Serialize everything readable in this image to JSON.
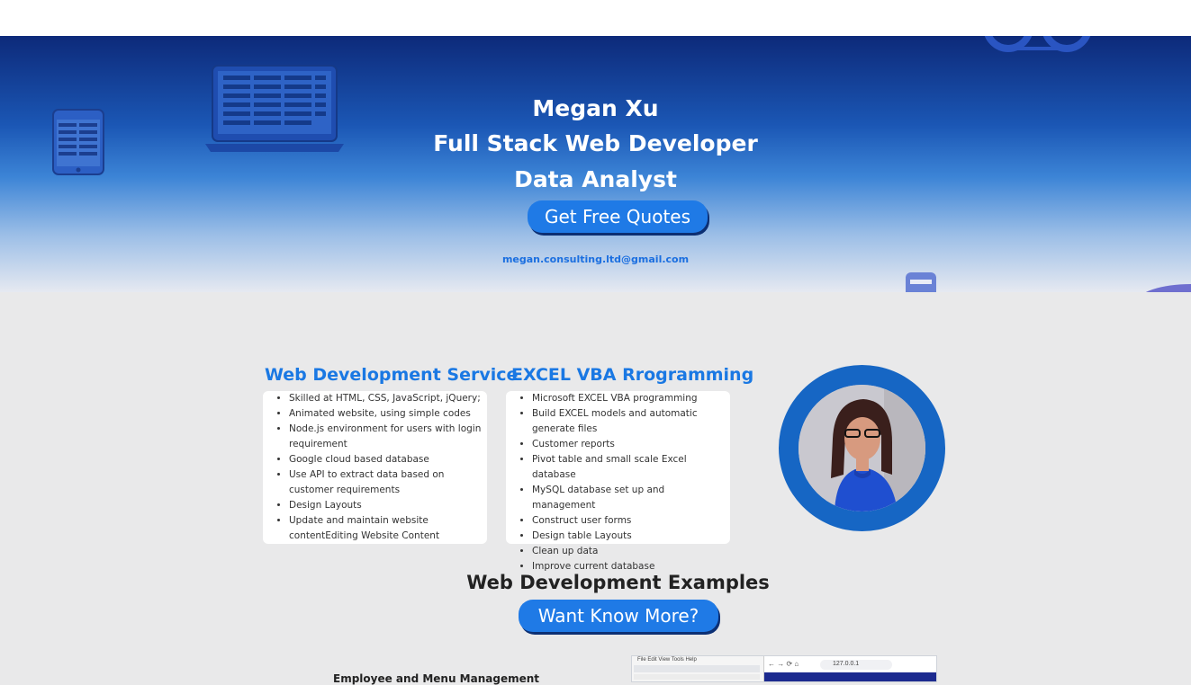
{
  "hero": {
    "name": "Megan Xu",
    "role1": "Full Stack Web Developer",
    "role2": "Data Analyst",
    "quote_button": "Get Free Quotes",
    "email": "megan.consulting.ltd@gmail.com",
    "decorations": [
      "tablet-icon",
      "laptop-icon",
      "phone-icon",
      "gears-icon"
    ]
  },
  "services": [
    {
      "title": "Web Development Service",
      "items": [
        "Skilled at HTML, CSS, JavaScript, jQuery;",
        "Animated website, using simple codes",
        "Node.js environment for users with login requirement",
        "Google cloud based database",
        "Use API to extract data based on customer requirements",
        "Design Layouts",
        "Update and maintain website contentEditing Website Content"
      ]
    },
    {
      "title": "EXCEL VBA Rrogramming",
      "items": [
        "Microsoft EXCEL VBA programming",
        "Build EXCEL models and automatic generate files",
        "Customer reports",
        "Pivot table and small scale Excel database",
        "MySQL database set up and management",
        "Construct user forms",
        "Design table Layouts",
        "Clean up data",
        "Improve current database"
      ]
    }
  ],
  "examples": {
    "title": "Web Development Examples",
    "more_button": "Want Know More?",
    "peek_caption": "Employee and Menu Management",
    "peek_menu": "File  Edit  View  Tools  Help",
    "peek_address": "127.0.0.1"
  },
  "colors": {
    "accent": "#1f7ae6",
    "title_blue": "#1a78e3",
    "background": "#e9e9ea"
  }
}
